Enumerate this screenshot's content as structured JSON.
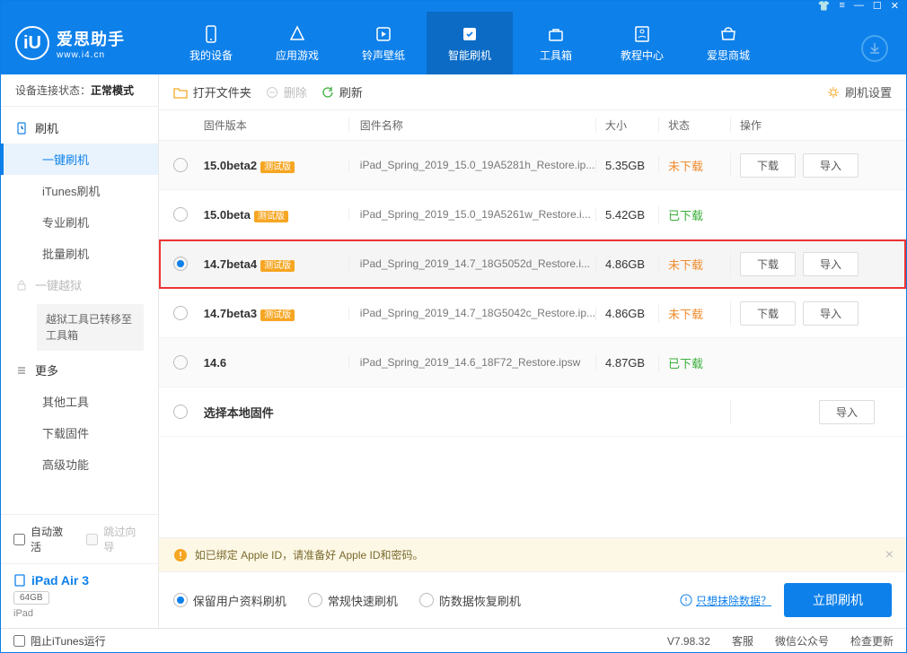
{
  "brand": {
    "name": "爱思助手",
    "url": "www.i4.cn"
  },
  "nav": {
    "tabs": [
      "我的设备",
      "应用游戏",
      "铃声壁纸",
      "智能刷机",
      "工具箱",
      "教程中心",
      "爱思商城"
    ],
    "active": 3
  },
  "sidebar": {
    "conn_label": "设备连接状态：",
    "conn_value": "正常模式",
    "groups": {
      "flash": {
        "title": "刷机",
        "items": [
          "一键刷机",
          "iTunes刷机",
          "专业刷机",
          "批量刷机"
        ],
        "active": 0
      },
      "jailbreak": {
        "title": "一键越狱",
        "note": "越狱工具已转移至工具箱"
      },
      "more": {
        "title": "更多",
        "items": [
          "其他工具",
          "下载固件",
          "高级功能"
        ]
      }
    },
    "auto_activate": "自动激活",
    "skip_guide": "跳过向导",
    "device": {
      "name": "iPad Air 3",
      "storage": "64GB",
      "type": "iPad"
    },
    "block_itunes": "阻止iTunes运行"
  },
  "toolbar": {
    "open": "打开文件夹",
    "delete": "删除",
    "refresh": "刷新",
    "settings": "刷机设置"
  },
  "table": {
    "headers": {
      "version": "固件版本",
      "name": "固件名称",
      "size": "大小",
      "status": "状态",
      "ops": "操作"
    },
    "badge": "测试版",
    "btn_download": "下载",
    "btn_import": "导入",
    "local_label": "选择本地固件",
    "status_no": "未下载",
    "status_yes": "已下载",
    "rows": [
      {
        "ver": "15.0beta2",
        "beta": true,
        "name": "iPad_Spring_2019_15.0_19A5281h_Restore.ip...",
        "size": "5.35GB",
        "status": "no",
        "ops": true
      },
      {
        "ver": "15.0beta",
        "beta": true,
        "name": "iPad_Spring_2019_15.0_19A5261w_Restore.i...",
        "size": "5.42GB",
        "status": "yes",
        "ops": false
      },
      {
        "ver": "14.7beta4",
        "beta": true,
        "name": "iPad_Spring_2019_14.7_18G5052d_Restore.i...",
        "size": "4.86GB",
        "status": "no",
        "ops": true,
        "selected": true,
        "hl": true
      },
      {
        "ver": "14.7beta3",
        "beta": true,
        "name": "iPad_Spring_2019_14.7_18G5042c_Restore.ip...",
        "size": "4.86GB",
        "status": "no",
        "ops": true
      },
      {
        "ver": "14.6",
        "beta": false,
        "name": "iPad_Spring_2019_14.6_18F72_Restore.ipsw",
        "size": "4.87GB",
        "status": "yes",
        "ops": false
      }
    ]
  },
  "alert": "如已绑定 Apple ID，请准备好 Apple ID和密码。",
  "flash_opts": {
    "opts": [
      "保留用户资料刷机",
      "常规快速刷机",
      "防数据恢复刷机"
    ],
    "selected": 0,
    "erase_link": "只想抹除数据？",
    "go": "立即刷机"
  },
  "footer": {
    "version": "V7.98.32",
    "items": [
      "客服",
      "微信公众号",
      "检查更新"
    ]
  }
}
